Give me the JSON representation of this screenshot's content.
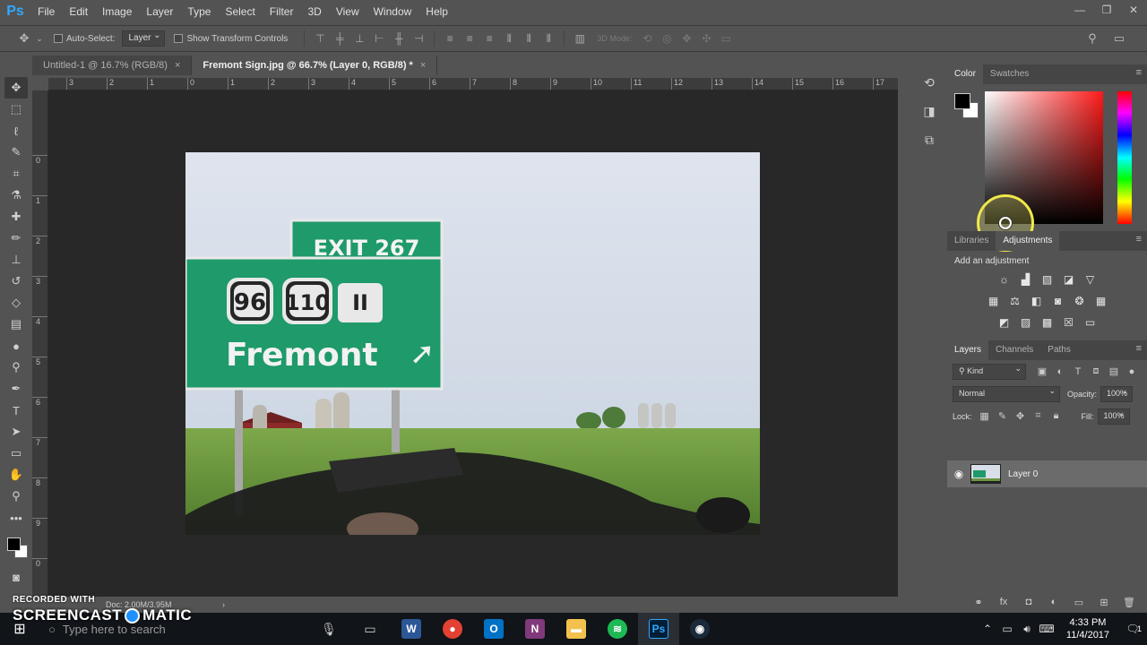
{
  "app": {
    "logo": "Ps"
  },
  "menu": [
    "File",
    "Edit",
    "Image",
    "Layer",
    "Type",
    "Select",
    "Filter",
    "3D",
    "View",
    "Window",
    "Help"
  ],
  "window_controls": {
    "minimize": "—",
    "restore": "❐",
    "close": "✕"
  },
  "options_bar": {
    "auto_select_label": "Auto-Select:",
    "auto_select_value": "Layer",
    "transform_label": "Show Transform Controls",
    "threed_mode_label": "3D Mode:"
  },
  "tabs": [
    {
      "label": "Untitled-1 @ 16.7% (RGB/8)",
      "close": "×"
    },
    {
      "label": "Fremont Sign.jpg @ 66.7% (Layer 0, RGB/8) *",
      "close": "×"
    }
  ],
  "ruler_h": [
    "3",
    "2",
    "1",
    "0",
    "1",
    "2",
    "3",
    "4",
    "5",
    "6",
    "7",
    "8",
    "9",
    "10",
    "11",
    "12",
    "13",
    "14",
    "15",
    "16",
    "17"
  ],
  "ruler_v": [
    "0",
    "1",
    "2",
    "3",
    "4",
    "5",
    "6",
    "7",
    "8",
    "9",
    "0"
  ],
  "image": {
    "exit_text": "EXIT 267",
    "route_1": "96",
    "route_2": "110",
    "route_3": "II",
    "place": "Fremont",
    "arrow": "➚"
  },
  "status": {
    "zoom": "",
    "doc": "Doc: 2.00M/3.95M",
    "arrow": "›"
  },
  "color_panel": {
    "tabs": [
      "Color",
      "Swatches"
    ]
  },
  "adjust_panel": {
    "tabs": [
      "Libraries",
      "Adjustments"
    ],
    "title": "Add an adjustment"
  },
  "layers_panel": {
    "tabs": [
      "Layers",
      "Channels",
      "Paths"
    ],
    "kind_label": "Kind",
    "blend_mode": "Normal",
    "opacity_label": "Opacity:",
    "opacity_value": "100%",
    "lock_label": "Lock:",
    "fill_label": "Fill:",
    "fill_value": "100%",
    "layer_name": "Layer 0"
  },
  "taskbar": {
    "search_placeholder": "Type here to search",
    "time": "4:33 PM",
    "date": "11/4/2017",
    "notification_count": "1"
  },
  "watermark": {
    "line1": "RECORDED WITH",
    "line2a": "SCREENCAST",
    "line2b": "MATIC"
  },
  "colors": {
    "accent": "#31a8ff",
    "panel": "#535353",
    "canvas_bg": "#282828",
    "sign_green": "#1f9a6a"
  }
}
